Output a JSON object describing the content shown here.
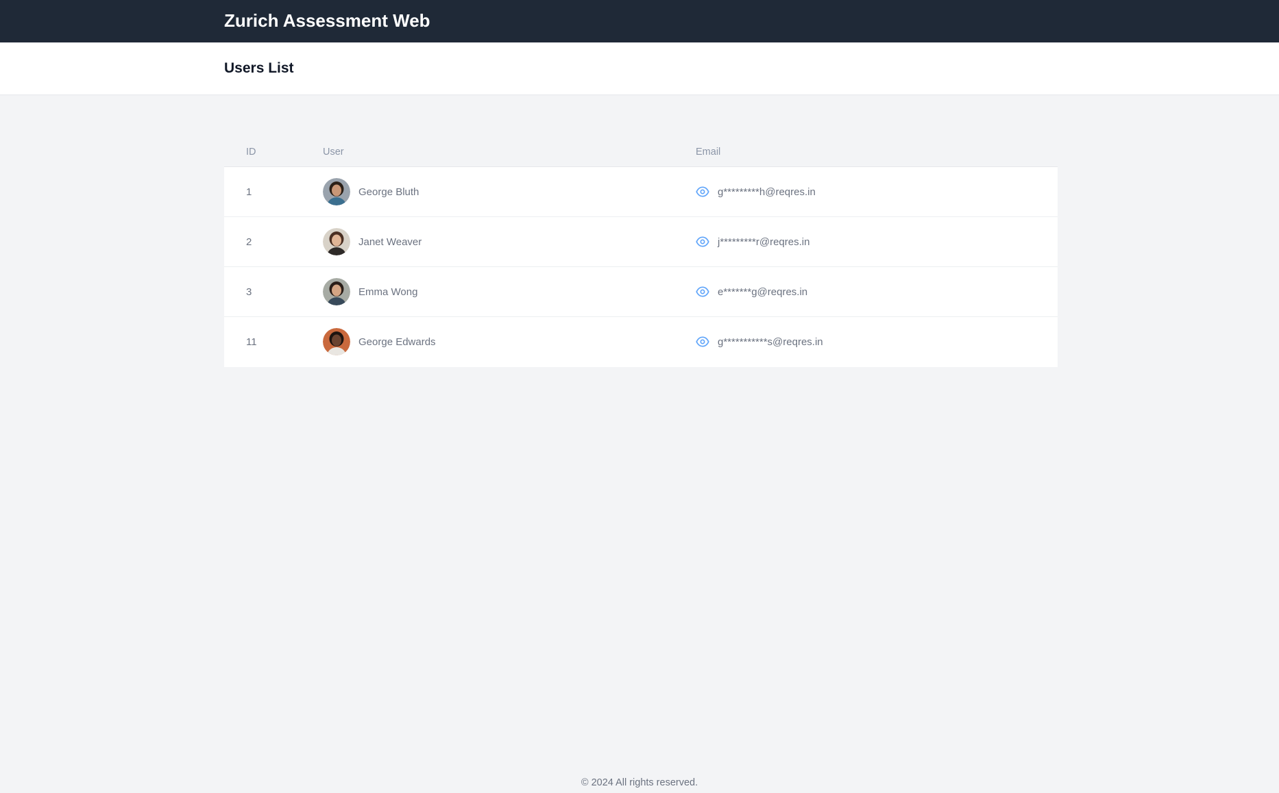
{
  "header": {
    "app_title": "Zurich Assessment Web"
  },
  "subheader": {
    "page_title": "Users List"
  },
  "table": {
    "columns": [
      "ID",
      "User",
      "Email"
    ],
    "rows": [
      {
        "id": "1",
        "name": "George Bluth",
        "email": "g*********h@reqres.in",
        "avatar_colors": {
          "bg": "#9aa3ad",
          "skin": "#c99777",
          "hair": "#2b2018",
          "shirt": "#3b6f8f"
        }
      },
      {
        "id": "2",
        "name": "Janet Weaver",
        "email": "j*********r@reqres.in",
        "avatar_colors": {
          "bg": "#d8d2c8",
          "skin": "#e0b596",
          "hair": "#4a2f22",
          "shirt": "#2e2a28"
        }
      },
      {
        "id": "3",
        "name": "Emma Wong",
        "email": "e*******g@reqres.in",
        "avatar_colors": {
          "bg": "#a7aba4",
          "skin": "#d4a584",
          "hair": "#2a1e18",
          "shirt": "#384a5a"
        }
      },
      {
        "id": "11",
        "name": "George Edwards",
        "email": "g***********s@reqres.in",
        "avatar_colors": {
          "bg": "#c9693d",
          "skin": "#6a4330",
          "hair": "#1d1410",
          "shirt": "#e9e6e1"
        }
      }
    ]
  },
  "icons": {
    "reveal_email": "eye-icon"
  },
  "colors": {
    "topbar": "#1f2937",
    "accent": "#60a5fa",
    "background": "#f3f4f6"
  },
  "footer": {
    "text": "© 2024 All rights reserved."
  }
}
